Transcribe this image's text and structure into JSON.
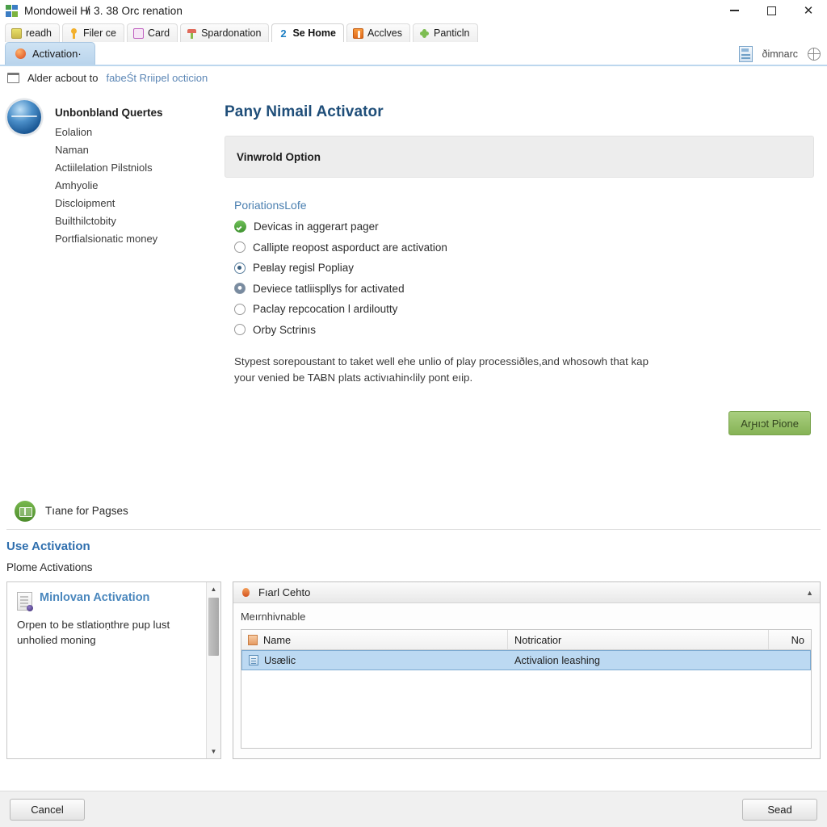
{
  "window": {
    "title": "Mondoweil H̸i 3. 38 Orc renation",
    "logo_icon": "app-grid-logo",
    "controls": {
      "minimize": "minimize-icon",
      "maximize": "maximize-icon",
      "close": "✕"
    }
  },
  "ribbon_tabs": [
    {
      "label": "readh",
      "icon": "folder-icon",
      "active": false
    },
    {
      "label": "Filer ce",
      "icon": "key-icon",
      "active": false
    },
    {
      "label": "Card",
      "icon": "card-icon",
      "active": false
    },
    {
      "label": "Spardonation",
      "icon": "umbrella-icon",
      "active": false
    },
    {
      "label": "Se Home",
      "icon": "number-two-icon",
      "active": true
    },
    {
      "label": "Acclves",
      "icon": "battery-icon",
      "active": false
    },
    {
      "label": "Panticln",
      "icon": "puzzle-icon",
      "active": false
    }
  ],
  "doc_row": {
    "tab_label": "Activation·",
    "tab_icon": "firefox-orb-icon",
    "right_label": "ðimnarс",
    "right_doc_icon": "document-icon",
    "right_globe_icon": "globe-icon"
  },
  "notification": {
    "icon": "window-icon",
    "text": "Alder acbout to",
    "link": "fabeŚt Rriipel octicion"
  },
  "left_nav": {
    "orb_icon": "blue-orb-icon",
    "heading": "Unbonbland Quertes",
    "items": [
      "Eolalion",
      "Naman",
      "Actiilelation Pilstniols",
      "Amhyolie",
      "Discloipment",
      "Builthilctobity",
      "Portfialsionatic money"
    ]
  },
  "main": {
    "title": "Pany Nimail Activator",
    "option_bar_label": "Vinwrold Option",
    "options_heading": "PoriationsLofe",
    "options": [
      {
        "label": "Devicas in aggerart pager",
        "state": "checked-green"
      },
      {
        "label": "Callipte reopost asporduct are activation",
        "state": "empty"
      },
      {
        "label": "Peʙlay regisl Popliay",
        "state": "selected"
      },
      {
        "label": "Deviece tatliispllys for activated",
        "state": "semi"
      },
      {
        "label": "Paclay repcocation l ardiloutty",
        "state": "empty"
      },
      {
        "label": "Orby Sctrinıs",
        "state": "empty"
      }
    ],
    "note": "Stypest sorepoustant to taket well ehe unlio of play processiðles,and whosowh that kap your venied be TAɃN plats activıahin‹lily pont eıip.",
    "apply_button": "Arԩıɔt Pione"
  },
  "trans_row": {
    "icon": "green-board-icon",
    "label": "Tıane for Pagses"
  },
  "use_section": {
    "heading": "Use Activation",
    "subheading": "Plome Activations"
  },
  "left_panel": {
    "doc_icon": "document-with-badge-icon",
    "title": "Minlovan Activation",
    "text": "Orpen to be stlatioṇthre pup lust unholied moning",
    "scroll_up": "▲",
    "scroll_down": "▼"
  },
  "right_panel": {
    "header_icon": "flame-icon",
    "header_label": "Fıarl Cehto",
    "collapse_icon": "chevron-up-icon",
    "subheading": "Meırnhivnable",
    "grid": {
      "columns": [
        {
          "label": "Name",
          "icon": "name-column-icon"
        },
        {
          "label": "Notricatior",
          "icon": ""
        },
        {
          "label": "No",
          "icon": ""
        }
      ],
      "rows": [
        {
          "name": "Usælic",
          "notification": "Activalion leashing",
          "no": "",
          "icon": "record-icon",
          "selected": true
        }
      ]
    }
  },
  "footer": {
    "cancel_label": "Cancel",
    "send_label": "Sead"
  },
  "colors": {
    "accent_blue": "#1f4e79",
    "link_blue": "#2f6fae",
    "apply_green": "#86b356",
    "selection_blue": "#bcd9f2"
  }
}
